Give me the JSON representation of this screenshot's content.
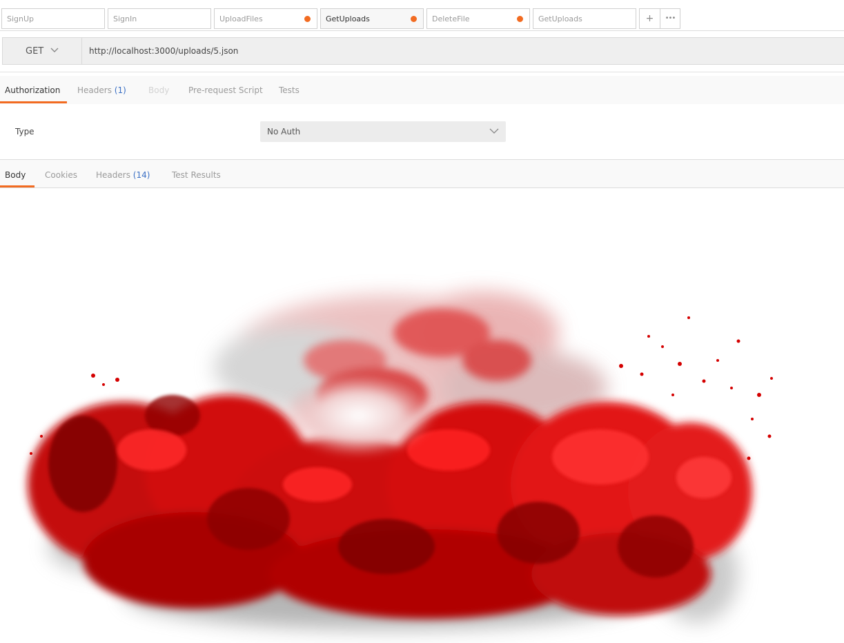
{
  "request_tabs": [
    {
      "label": "SignUp",
      "unsaved": false,
      "active": false
    },
    {
      "label": "SignIn",
      "unsaved": false,
      "active": false
    },
    {
      "label": "UploadFiles",
      "unsaved": true,
      "active": false
    },
    {
      "label": "GetUploads",
      "unsaved": true,
      "active": true
    },
    {
      "label": "DeleteFile",
      "unsaved": true,
      "active": false
    },
    {
      "label": "GetUploads",
      "unsaved": false,
      "active": false
    }
  ],
  "tab_actions": {
    "add_icon": "plus-icon",
    "more_icon": "ellipsis-icon",
    "add_glyph": "+",
    "more_glyph": "•••"
  },
  "request": {
    "method": "GET",
    "url": "http://localhost:3000/uploads/5.json"
  },
  "request_options_tabs": {
    "authorization": "Authorization",
    "headers": "Headers",
    "headers_count": "(1)",
    "body": "Body",
    "prerequest": "Pre-request Script",
    "tests": "Tests"
  },
  "auth": {
    "type_label": "Type",
    "type_value": "No Auth"
  },
  "response_tabs": {
    "body": "Body",
    "cookies": "Cookies",
    "headers": "Headers",
    "headers_count": "(14)",
    "test_results": "Test Results"
  },
  "response_body": {
    "content": "red-smoke-image"
  },
  "colors": {
    "accent": "#f26b21",
    "count": "#3a6fc4",
    "smoke_primary": "#e00b0b",
    "smoke_dark": "#8a0000"
  }
}
